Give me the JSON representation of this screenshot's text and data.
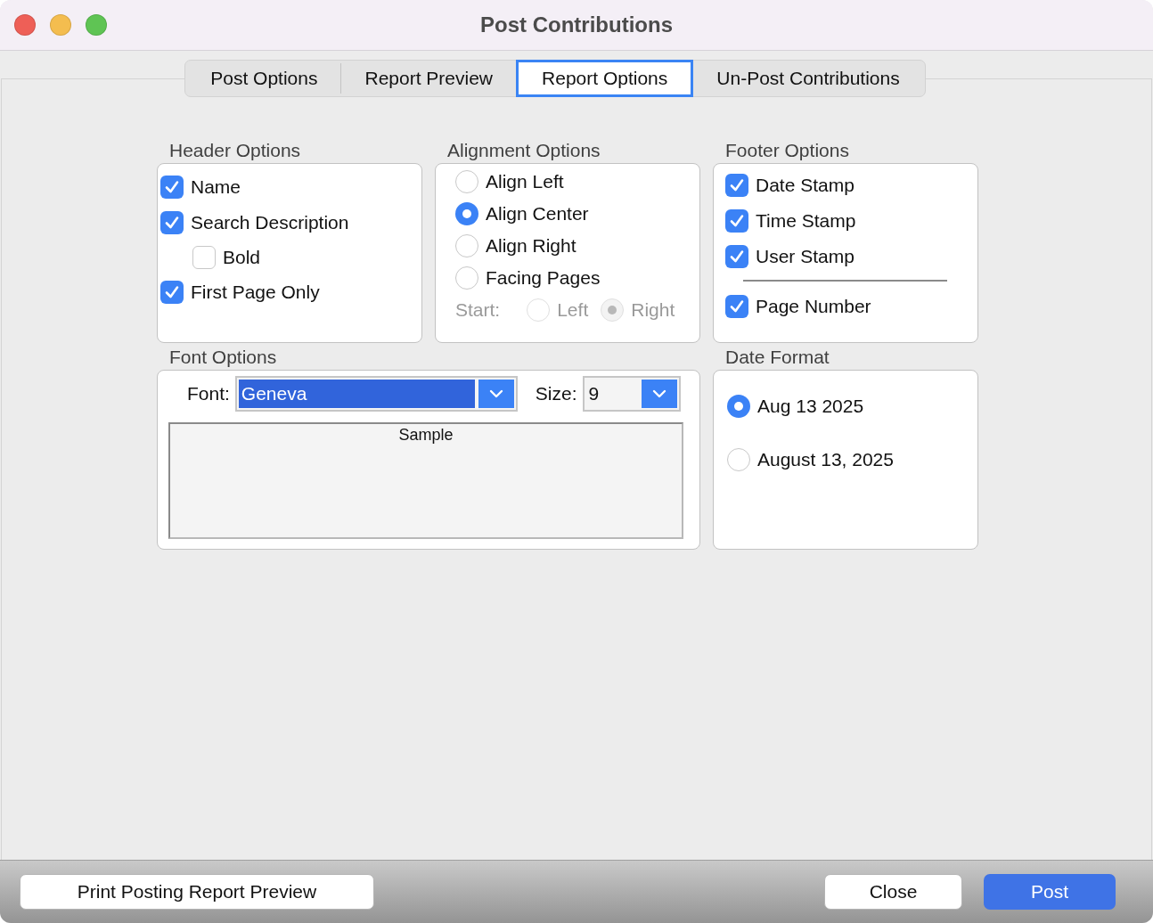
{
  "window": {
    "title": "Post Contributions"
  },
  "tabs": [
    {
      "label": "Post Options",
      "selected": false
    },
    {
      "label": "Report Preview",
      "selected": false
    },
    {
      "label": "Report Options",
      "selected": true
    },
    {
      "label": "Un-Post Contributions",
      "selected": false
    }
  ],
  "header_options": {
    "title": "Header Options",
    "items": [
      {
        "label": "Name",
        "checked": true
      },
      {
        "label": "Search Description",
        "checked": true,
        "children": [
          {
            "label": "Bold",
            "checked": false
          }
        ]
      },
      {
        "label": "First Page Only",
        "checked": true
      }
    ]
  },
  "alignment_options": {
    "title": "Alignment Options",
    "items": [
      {
        "label": "Align Left",
        "selected": false
      },
      {
        "label": "Align Center",
        "selected": true
      },
      {
        "label": "Align Right",
        "selected": false
      },
      {
        "label": "Facing Pages",
        "selected": false
      }
    ],
    "start": {
      "label": "Start:",
      "disabled": true,
      "options": [
        {
          "label": "Left",
          "selected": false
        },
        {
          "label": "Right",
          "selected": true
        }
      ]
    }
  },
  "footer_options": {
    "title": "Footer Options",
    "items": [
      {
        "label": "Date Stamp",
        "checked": true,
        "divider_before": false
      },
      {
        "label": "Time Stamp",
        "checked": true,
        "divider_before": false
      },
      {
        "label": "User Stamp",
        "checked": true,
        "divider_before": false
      },
      {
        "label": "Page Number",
        "checked": true,
        "divider_before": true
      }
    ]
  },
  "font_options": {
    "title": "Font Options",
    "font_label": "Font:",
    "font_value": "Geneva",
    "font_highlighted": true,
    "size_label": "Size:",
    "size_value": "9",
    "sample": "Sample"
  },
  "date_format": {
    "title": "Date Format",
    "options": [
      {
        "label": "Aug 13 2025",
        "selected": true
      },
      {
        "label": "August 13, 2025",
        "selected": false
      }
    ]
  },
  "footer": {
    "left": [
      {
        "label": "Print Posting Report Preview",
        "kind": "plain"
      }
    ],
    "right": [
      {
        "label": "Close",
        "kind": "plain"
      },
      {
        "label": "Post",
        "kind": "primary"
      }
    ]
  }
}
